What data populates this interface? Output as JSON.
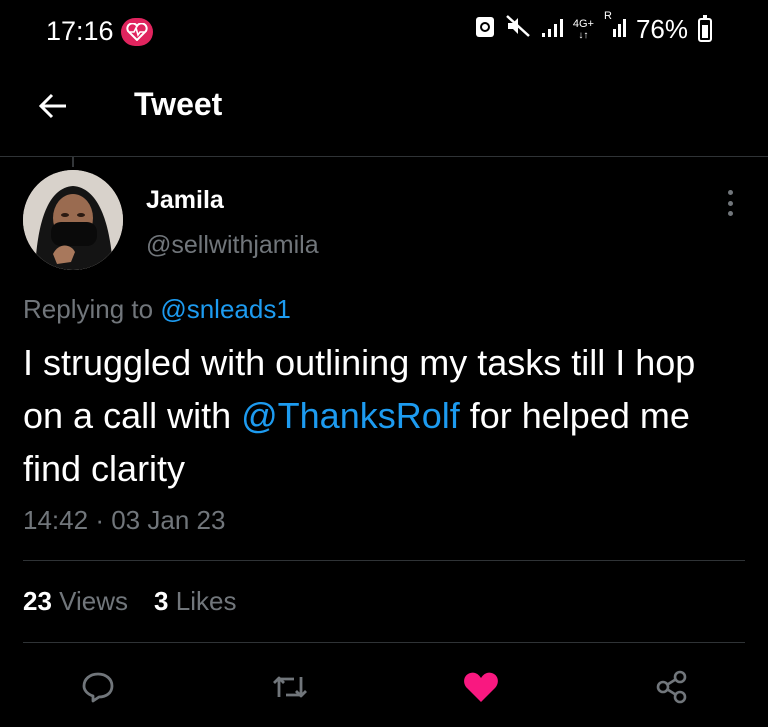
{
  "status_bar": {
    "time": "17:16",
    "network": "4G+",
    "roaming": "R",
    "battery": "76%"
  },
  "header": {
    "title": "Tweet"
  },
  "tweet": {
    "author_name": "Jamila",
    "author_handle": "@sellwithjamila",
    "replying_prefix": "Replying to",
    "replying_to": "@snleads1",
    "text_part1": "I struggled with outlining my tasks till I hop on a call with ",
    "text_mention": "@ThanksRolf",
    "text_part2": " for helped me find clarity",
    "time": "14:42",
    "date": "03 Jan 23",
    "separator": "·",
    "views_count": "23",
    "views_label": "Views",
    "likes_count": "3",
    "likes_label": "Likes"
  },
  "colors": {
    "background": "#000000",
    "accent": "#1d9bf0",
    "like": "#f91880",
    "muted": "#71767b"
  },
  "icons": [
    "back-arrow-icon",
    "reply-icon",
    "retweet-icon",
    "like-heart-icon",
    "share-icon",
    "more-options-icon"
  ]
}
